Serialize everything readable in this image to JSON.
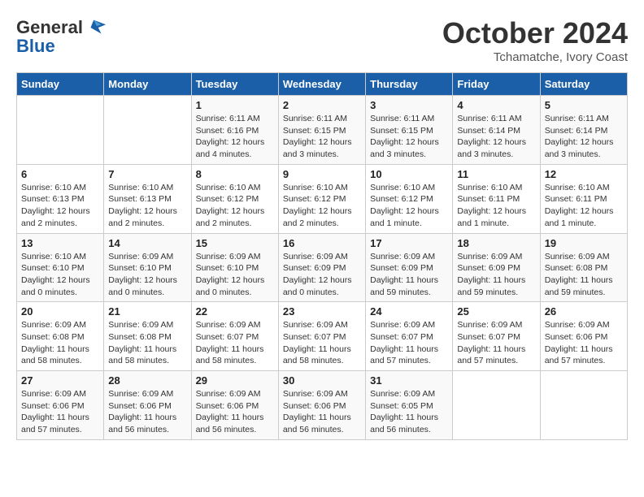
{
  "header": {
    "logo": {
      "general": "General",
      "blue": "Blue"
    },
    "title": "October 2024",
    "location": "Tchamatche, Ivory Coast"
  },
  "weekdays": [
    "Sunday",
    "Monday",
    "Tuesday",
    "Wednesday",
    "Thursday",
    "Friday",
    "Saturday"
  ],
  "weeks": [
    [
      {
        "day": "",
        "info": ""
      },
      {
        "day": "",
        "info": ""
      },
      {
        "day": "1",
        "info": "Sunrise: 6:11 AM\nSunset: 6:16 PM\nDaylight: 12 hours\nand 4 minutes."
      },
      {
        "day": "2",
        "info": "Sunrise: 6:11 AM\nSunset: 6:15 PM\nDaylight: 12 hours\nand 3 minutes."
      },
      {
        "day": "3",
        "info": "Sunrise: 6:11 AM\nSunset: 6:15 PM\nDaylight: 12 hours\nand 3 minutes."
      },
      {
        "day": "4",
        "info": "Sunrise: 6:11 AM\nSunset: 6:14 PM\nDaylight: 12 hours\nand 3 minutes."
      },
      {
        "day": "5",
        "info": "Sunrise: 6:11 AM\nSunset: 6:14 PM\nDaylight: 12 hours\nand 3 minutes."
      }
    ],
    [
      {
        "day": "6",
        "info": "Sunrise: 6:10 AM\nSunset: 6:13 PM\nDaylight: 12 hours\nand 2 minutes."
      },
      {
        "day": "7",
        "info": "Sunrise: 6:10 AM\nSunset: 6:13 PM\nDaylight: 12 hours\nand 2 minutes."
      },
      {
        "day": "8",
        "info": "Sunrise: 6:10 AM\nSunset: 6:12 PM\nDaylight: 12 hours\nand 2 minutes."
      },
      {
        "day": "9",
        "info": "Sunrise: 6:10 AM\nSunset: 6:12 PM\nDaylight: 12 hours\nand 2 minutes."
      },
      {
        "day": "10",
        "info": "Sunrise: 6:10 AM\nSunset: 6:12 PM\nDaylight: 12 hours\nand 1 minute."
      },
      {
        "day": "11",
        "info": "Sunrise: 6:10 AM\nSunset: 6:11 PM\nDaylight: 12 hours\nand 1 minute."
      },
      {
        "day": "12",
        "info": "Sunrise: 6:10 AM\nSunset: 6:11 PM\nDaylight: 12 hours\nand 1 minute."
      }
    ],
    [
      {
        "day": "13",
        "info": "Sunrise: 6:10 AM\nSunset: 6:10 PM\nDaylight: 12 hours\nand 0 minutes."
      },
      {
        "day": "14",
        "info": "Sunrise: 6:09 AM\nSunset: 6:10 PM\nDaylight: 12 hours\nand 0 minutes."
      },
      {
        "day": "15",
        "info": "Sunrise: 6:09 AM\nSunset: 6:10 PM\nDaylight: 12 hours\nand 0 minutes."
      },
      {
        "day": "16",
        "info": "Sunrise: 6:09 AM\nSunset: 6:09 PM\nDaylight: 12 hours\nand 0 minutes."
      },
      {
        "day": "17",
        "info": "Sunrise: 6:09 AM\nSunset: 6:09 PM\nDaylight: 11 hours\nand 59 minutes."
      },
      {
        "day": "18",
        "info": "Sunrise: 6:09 AM\nSunset: 6:09 PM\nDaylight: 11 hours\nand 59 minutes."
      },
      {
        "day": "19",
        "info": "Sunrise: 6:09 AM\nSunset: 6:08 PM\nDaylight: 11 hours\nand 59 minutes."
      }
    ],
    [
      {
        "day": "20",
        "info": "Sunrise: 6:09 AM\nSunset: 6:08 PM\nDaylight: 11 hours\nand 58 minutes."
      },
      {
        "day": "21",
        "info": "Sunrise: 6:09 AM\nSunset: 6:08 PM\nDaylight: 11 hours\nand 58 minutes."
      },
      {
        "day": "22",
        "info": "Sunrise: 6:09 AM\nSunset: 6:07 PM\nDaylight: 11 hours\nand 58 minutes."
      },
      {
        "day": "23",
        "info": "Sunrise: 6:09 AM\nSunset: 6:07 PM\nDaylight: 11 hours\nand 58 minutes."
      },
      {
        "day": "24",
        "info": "Sunrise: 6:09 AM\nSunset: 6:07 PM\nDaylight: 11 hours\nand 57 minutes."
      },
      {
        "day": "25",
        "info": "Sunrise: 6:09 AM\nSunset: 6:07 PM\nDaylight: 11 hours\nand 57 minutes."
      },
      {
        "day": "26",
        "info": "Sunrise: 6:09 AM\nSunset: 6:06 PM\nDaylight: 11 hours\nand 57 minutes."
      }
    ],
    [
      {
        "day": "27",
        "info": "Sunrise: 6:09 AM\nSunset: 6:06 PM\nDaylight: 11 hours\nand 57 minutes."
      },
      {
        "day": "28",
        "info": "Sunrise: 6:09 AM\nSunset: 6:06 PM\nDaylight: 11 hours\nand 56 minutes."
      },
      {
        "day": "29",
        "info": "Sunrise: 6:09 AM\nSunset: 6:06 PM\nDaylight: 11 hours\nand 56 minutes."
      },
      {
        "day": "30",
        "info": "Sunrise: 6:09 AM\nSunset: 6:06 PM\nDaylight: 11 hours\nand 56 minutes."
      },
      {
        "day": "31",
        "info": "Sunrise: 6:09 AM\nSunset: 6:05 PM\nDaylight: 11 hours\nand 56 minutes."
      },
      {
        "day": "",
        "info": ""
      },
      {
        "day": "",
        "info": ""
      }
    ]
  ]
}
